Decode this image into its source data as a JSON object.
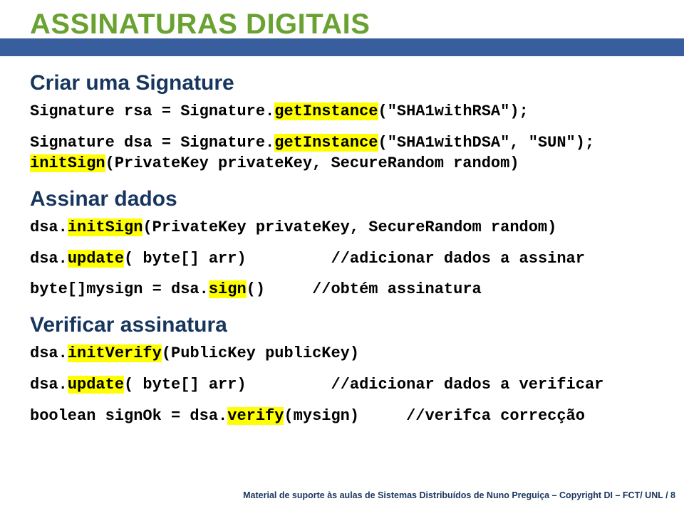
{
  "title": "ASSINATURAS DIGITAIS",
  "sec1": {
    "heading": "Criar uma Signature",
    "line1a": "Signature rsa = Signature.",
    "line1b": "getInstance",
    "line1c": "(\"SHA1withRSA\");",
    "line2a": "Signature dsa = Signature.",
    "line2b": "getInstance",
    "line2c": "(\"SHA1withDSA\", \"SUN\");",
    "line3a": "initSign",
    "line3b": "(PrivateKey privateKey, SecureRandom random)"
  },
  "sec2": {
    "heading": "Assinar dados",
    "line1a": "dsa.",
    "line1b": "initSign",
    "line1c": "(PrivateKey privateKey, SecureRandom random)",
    "line2a": "dsa.",
    "line2b": "update",
    "line2c": "( byte[] arr)",
    "line2pad": "         ",
    "line2comment": "//adicionar dados a assinar",
    "line3a": "byte[]mysign = dsa.",
    "line3b": "sign",
    "line3c": "()",
    "line3pad": "     ",
    "line3comment": "//obtém assinatura"
  },
  "sec3": {
    "heading": "Verificar assinatura",
    "line1a": "dsa.",
    "line1b": "initVerify",
    "line1c": "(PublicKey publicKey)",
    "line2a": "dsa.",
    "line2b": "update",
    "line2c": "( byte[] arr)",
    "line2pad": "         ",
    "line2comment": "//adicionar dados a verificar",
    "line3a": "boolean signOk = dsa.",
    "line3b": "verify",
    "line3c": "(mysign)",
    "line3pad": "     ",
    "line3comment": "//verifca correcção"
  },
  "footer": "Material de suporte às aulas de Sistemas Distribuídos de Nuno Preguiça – Copyright DI – FCT/ UNL / 8"
}
